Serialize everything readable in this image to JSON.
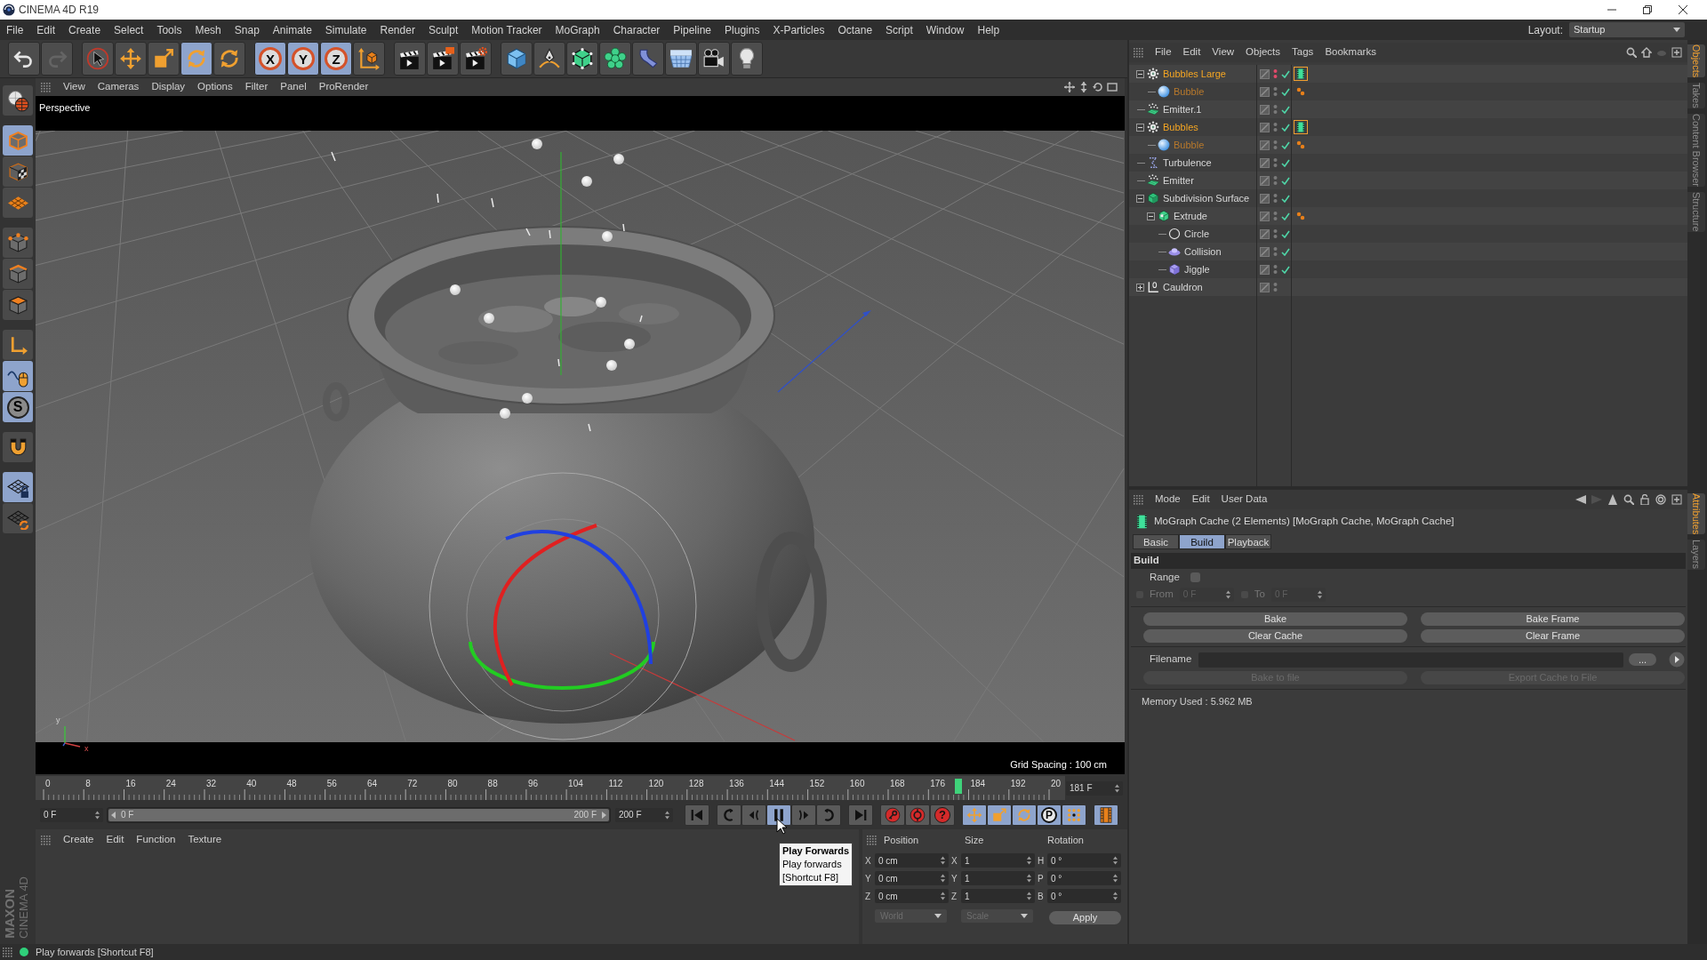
{
  "window": {
    "title": "CINEMA 4D R19"
  },
  "menu_bar": [
    "File",
    "Edit",
    "Create",
    "Select",
    "Tools",
    "Mesh",
    "Snap",
    "Animate",
    "Simulate",
    "Render",
    "Sculpt",
    "Motion Tracker",
    "MoGraph",
    "Character",
    "Pipeline",
    "Plugins",
    "X-Particles",
    "Octane",
    "Script",
    "Window",
    "Help"
  ],
  "layout": {
    "label": "Layout:",
    "value": "Startup"
  },
  "toolbar": [
    [
      {
        "kind": "undo",
        "active": false,
        "disabled": false
      },
      {
        "kind": "redo",
        "active": false,
        "disabled": true
      }
    ],
    [
      {
        "kind": "select",
        "active": false,
        "disabled": false
      },
      {
        "kind": "move",
        "active": false,
        "disabled": false
      },
      {
        "kind": "scale",
        "active": false,
        "disabled": false
      },
      {
        "kind": "rotate",
        "active": true,
        "disabled": false
      },
      {
        "kind": "rotate",
        "active": false,
        "disabled": false
      }
    ],
    [
      {
        "kind": "axis_lock",
        "label": "X",
        "active": true,
        "disabled": false
      },
      {
        "kind": "axis_lock",
        "label": "Y",
        "active": true,
        "disabled": false
      },
      {
        "kind": "axis_lock",
        "label": "Z",
        "active": true,
        "disabled": false
      },
      {
        "kind": "coordinates",
        "active": false,
        "disabled": false
      }
    ],
    [
      {
        "kind": "render_view",
        "active": false,
        "disabled": false
      },
      {
        "kind": "render_picture",
        "active": false,
        "disabled": false
      },
      {
        "kind": "render_settings",
        "active": false,
        "disabled": false
      }
    ],
    [
      {
        "kind": "cube",
        "active": false,
        "disabled": false
      },
      {
        "kind": "pen",
        "active": false,
        "disabled": false
      },
      {
        "kind": "subdivision",
        "active": false,
        "disabled": false
      },
      {
        "kind": "cloner",
        "active": false,
        "disabled": false
      },
      {
        "kind": "deformer",
        "active": false,
        "disabled": false
      },
      {
        "kind": "floor",
        "active": false,
        "disabled": false
      },
      {
        "kind": "camera",
        "active": false,
        "disabled": false
      },
      {
        "kind": "light",
        "active": false,
        "disabled": false
      }
    ]
  ],
  "tool_palette": [
    [
      {
        "kind": "globe",
        "active": false
      }
    ],
    [
      {
        "kind": "model",
        "active": true
      },
      {
        "kind": "pattern",
        "active": false
      },
      {
        "kind": "texture",
        "active": false
      }
    ],
    [
      {
        "kind": "points",
        "active": false
      },
      {
        "kind": "edges",
        "active": false
      },
      {
        "kind": "faces",
        "active": false
      }
    ],
    [
      {
        "kind": "axis",
        "active": false
      },
      {
        "kind": "tweak",
        "active": true
      },
      {
        "kind": "snap",
        "label": "S",
        "active": true
      }
    ],
    [
      {
        "kind": "magnet",
        "active": false
      }
    ],
    [
      {
        "kind": "grid_lock",
        "active": true
      },
      {
        "kind": "grid_refresh",
        "active": false
      }
    ]
  ],
  "viewport": {
    "menu": [
      "View",
      "Cameras",
      "Display",
      "Options",
      "Filter",
      "Panel",
      "ProRender"
    ],
    "camera": "Perspective",
    "axis_labels": [
      "y",
      "x"
    ],
    "grid_spacing": "Grid Spacing : 100 cm"
  },
  "timeline": {
    "ticks": [
      "0",
      "8",
      "16",
      "24",
      "32",
      "40",
      "48",
      "56",
      "64",
      "72",
      "80",
      "88",
      "96",
      "104",
      "112",
      "120",
      "128",
      "136",
      "144",
      "152",
      "160",
      "168",
      "176",
      "184",
      "192",
      "20"
    ],
    "level": 0.905,
    "current_frame": "181 F",
    "start_field": "0 F",
    "range": {
      "start": "0 F",
      "end": "200 F",
      "level": 1
    },
    "end_field": "200 F"
  },
  "transport": [
    [
      {
        "kind": "go_start",
        "active": false
      }
    ],
    [
      {
        "kind": "prev_key",
        "active": false
      },
      {
        "kind": "step_back",
        "active": false
      },
      {
        "kind": "pause",
        "active": true
      },
      {
        "kind": "step_forward",
        "active": false
      },
      {
        "kind": "next_key",
        "active": false
      }
    ],
    [
      {
        "kind": "go_end",
        "active": false
      }
    ],
    [
      {
        "kind": "record",
        "active": false
      },
      {
        "kind": "autokey",
        "active": false
      },
      {
        "kind": "key_help",
        "label": "?",
        "active": false
      }
    ],
    [
      {
        "kind": "key_move",
        "active": true
      },
      {
        "kind": "key_scale",
        "active": true
      },
      {
        "kind": "key_rotate",
        "active": true
      },
      {
        "kind": "key_param",
        "label": "P",
        "active": true
      },
      {
        "kind": "key_points",
        "active": true
      }
    ],
    [
      {
        "kind": "timeline",
        "active": true
      }
    ]
  ],
  "logo": {
    "brand": "MAXON",
    "product": "CINEMA 4D"
  },
  "material_manager": {
    "menu": [
      "Create",
      "Edit",
      "Function",
      "Texture"
    ]
  },
  "tooltip": {
    "title": "Play Forwards",
    "lines": [
      "Play forwards",
      "[Shortcut F8]"
    ]
  },
  "coordinates": {
    "headers": [
      "Position",
      "Size",
      "Rotation"
    ],
    "rows": [
      [
        {
          "axis": "X",
          "value": "0 cm"
        },
        {
          "axis": "X",
          "value": "1"
        },
        {
          "axis": "H",
          "value": "0 °"
        }
      ],
      [
        {
          "axis": "Y",
          "value": "0 cm"
        },
        {
          "axis": "Y",
          "value": "1"
        },
        {
          "axis": "P",
          "value": "0 °"
        }
      ],
      [
        {
          "axis": "Z",
          "value": "0 cm"
        },
        {
          "axis": "Z",
          "value": "1"
        },
        {
          "axis": "B",
          "value": "0 °"
        }
      ]
    ],
    "dropdowns": [
      {
        "value": "World",
        "disabled": true
      },
      {
        "value": "Scale",
        "disabled": true
      }
    ],
    "apply": "Apply"
  },
  "object_manager": {
    "menu": [
      "File",
      "Edit",
      "View",
      "Objects",
      "Tags",
      "Bookmarks"
    ],
    "tree": [
      {
        "label": "Bubbles Large",
        "kind": "mograph",
        "selected": true,
        "expanded": true,
        "hidden": true,
        "enabled": true,
        "tags": [
          {
            "kind": "cache",
            "selected": true
          }
        ],
        "children": [
          {
            "label": "Bubble",
            "kind": "sphere",
            "selected": false,
            "hidden": false,
            "enabled": true,
            "tags": [
              {
                "kind": "dots",
                "selected": false
              }
            ]
          }
        ]
      },
      {
        "label": "Emitter.1",
        "kind": "emitter",
        "selected": false,
        "hidden": false,
        "enabled": true
      },
      {
        "label": "Bubbles",
        "kind": "mograph",
        "selected": true,
        "expanded": true,
        "hidden": false,
        "enabled": true,
        "tags": [
          {
            "kind": "cache",
            "selected": true
          }
        ],
        "children": [
          {
            "label": "Bubble",
            "kind": "sphere",
            "selected": false,
            "hidden": false,
            "enabled": true,
            "tags": [
              {
                "kind": "dots",
                "selected": false
              }
            ]
          }
        ]
      },
      {
        "label": "Turbulence",
        "kind": "turbulence",
        "selected": false,
        "hidden": false,
        "enabled": true
      },
      {
        "label": "Emitter",
        "kind": "emitter",
        "selected": false,
        "hidden": false,
        "enabled": true
      },
      {
        "label": "Subdivision Surface",
        "kind": "subdivision",
        "selected": false,
        "expanded": true,
        "hidden": false,
        "enabled": true,
        "children": [
          {
            "label": "Extrude",
            "kind": "extrude",
            "selected": false,
            "expanded": true,
            "hidden": false,
            "enabled": true,
            "tags": [
              {
                "kind": "dots",
                "selected": false
              }
            ],
            "children": [
              {
                "label": "Circle",
                "kind": "circle",
                "selected": false,
                "hidden": false,
                "enabled": true
              },
              {
                "label": "Collision",
                "kind": "collision",
                "selected": false,
                "hidden": false,
                "enabled": true
              },
              {
                "label": "Jiggle",
                "kind": "jiggle",
                "selected": false,
                "hidden": false,
                "enabled": true
              }
            ]
          }
        ]
      },
      {
        "label": "Cauldron",
        "kind": "null",
        "selected": false,
        "expanded": false,
        "hidden": false,
        "enabled": false
      }
    ]
  },
  "object_tabs": [
    {
      "label": "Objects",
      "selected": true
    },
    {
      "label": "Takes",
      "selected": false
    },
    {
      "label": "Content Browser",
      "selected": false
    },
    {
      "label": "Structure",
      "selected": false
    }
  ],
  "attributes": {
    "menu": [
      "Mode",
      "Edit",
      "User Data"
    ],
    "title": "MoGraph Cache (2 Elements) [MoGraph Cache, MoGraph Cache]",
    "tabs": [
      {
        "label": "Basic",
        "selected": false
      },
      {
        "label": "Build",
        "selected": true
      },
      {
        "label": "Playback",
        "selected": false
      }
    ],
    "section": "Build",
    "range": {
      "label": "Range",
      "checked": false
    },
    "from": {
      "label": "From",
      "value": "0 F",
      "checked": false,
      "disabled": true
    },
    "to": {
      "label": "To",
      "value": "0 F",
      "checked": false,
      "disabled": true
    },
    "buttons": [
      {
        "label": "Bake",
        "disabled": false
      },
      {
        "label": "Bake Frame",
        "disabled": false
      },
      {
        "label": "Clear Cache",
        "disabled": false
      },
      {
        "label": "Clear Frame",
        "disabled": false
      }
    ],
    "filename": {
      "label": "Filename",
      "browse": "..."
    },
    "export_buttons": [
      {
        "label": "Bake to file",
        "disabled": true
      },
      {
        "label": "Export Cache to File",
        "disabled": true
      }
    ],
    "memory": "Memory Used : 5.962 MB"
  },
  "attribute_tabs": [
    {
      "label": "Attributes",
      "selected": true
    },
    {
      "label": "Layers",
      "selected": false
    }
  ],
  "status_bar": {
    "text": "Play forwards [Shortcut F8]"
  }
}
